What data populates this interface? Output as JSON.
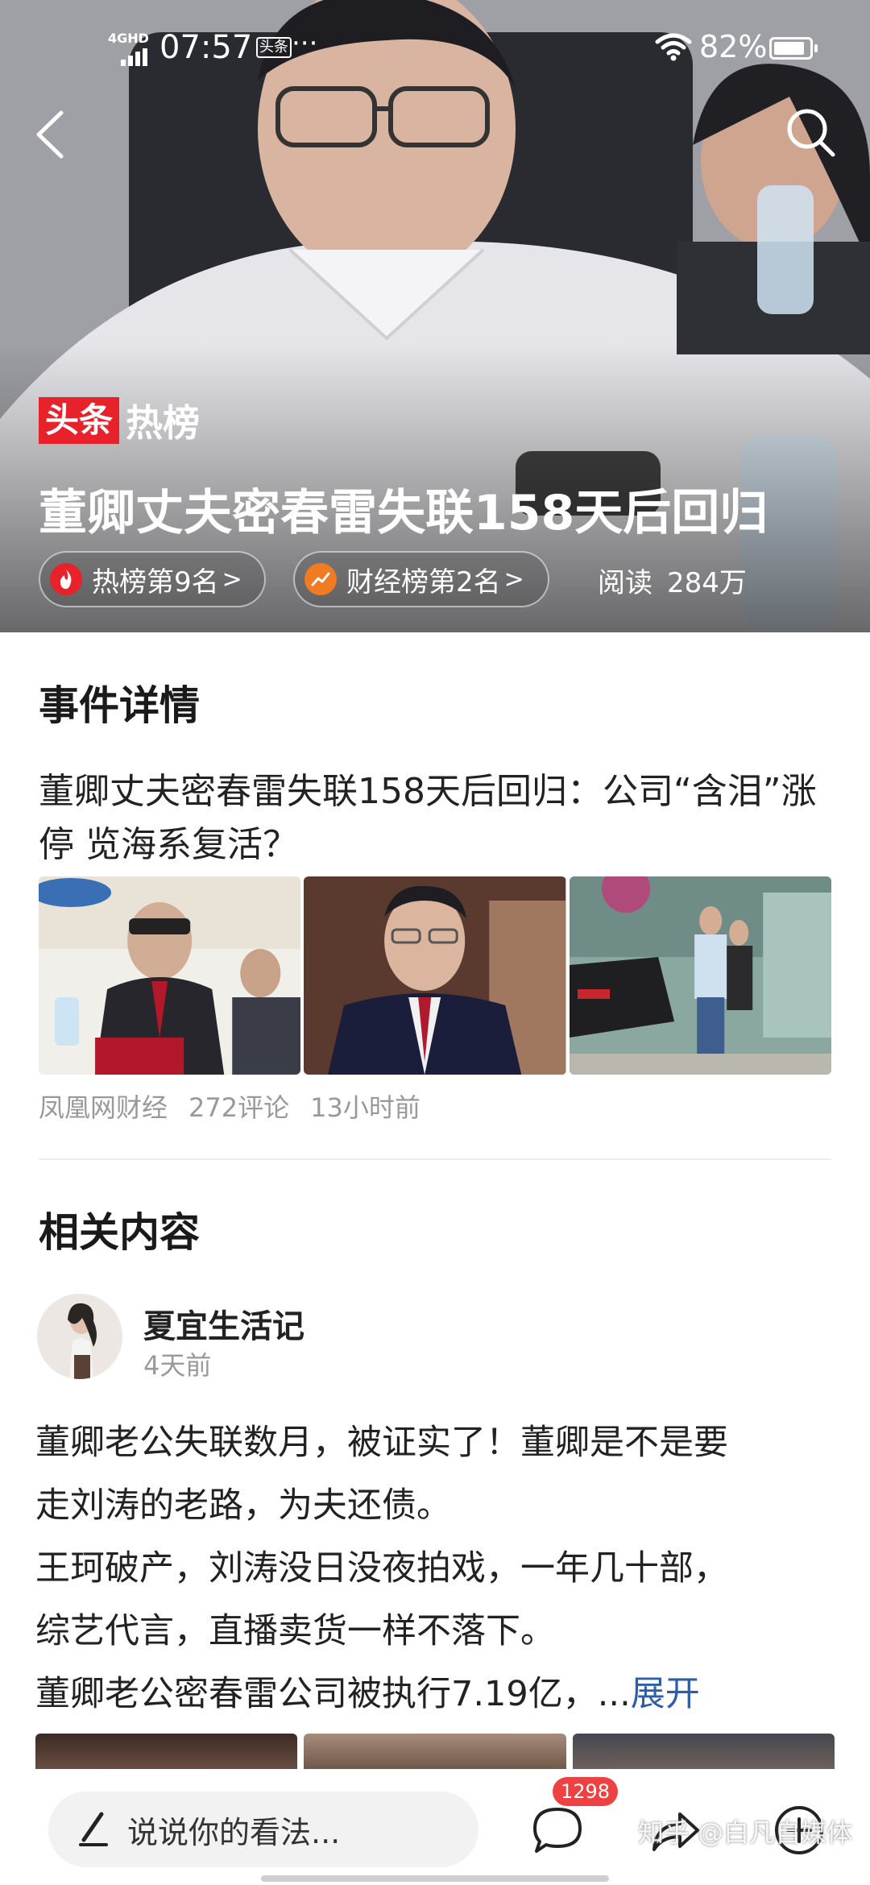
{
  "status_bar": {
    "network": "4GHD",
    "time": "07:57",
    "app_badge": "头条",
    "more": "···",
    "battery_pct": "82%"
  },
  "hero": {
    "logo_red": "头条",
    "logo_white": "热榜",
    "title": "董卿丈夫密春雷失联158天后回归",
    "rank_pill": {
      "label": "热榜第9名",
      "chevron": ">"
    },
    "finance_pill": {
      "label": "财经榜第2名",
      "chevron": ">"
    },
    "views_label": "阅读",
    "views_value": "284万"
  },
  "event": {
    "section_title": "事件详情",
    "headline": "董卿丈夫密春雷失联158天后回归：公司“含泪”涨停  览海系复活？",
    "source": "凤凰网财经",
    "comments": "272评论",
    "time": "13小时前"
  },
  "related": {
    "section_title": "相关内容",
    "author": "夏宜生活记",
    "time": "4天前",
    "body_lines": [
      "董卿老公失联数月，被证实了！董卿是不是要",
      "走刘涛的老路，为夫还债。",
      "王珂破产，刘涛没日没夜拍戏，一年几十部，",
      "综艺代言，直播卖货一样不落下。",
      "董卿老公密春雷公司被执行7.19亿，..."
    ],
    "expand_label": "展开"
  },
  "bottom_bar": {
    "input_placeholder": "说说你的看法...",
    "comment_count": "1298",
    "watermark": "知乎 @白凡自媒体"
  },
  "colors": {
    "brand_red": "#e8222a",
    "link_blue": "#2f5ea8",
    "badge_red": "#f04142"
  }
}
